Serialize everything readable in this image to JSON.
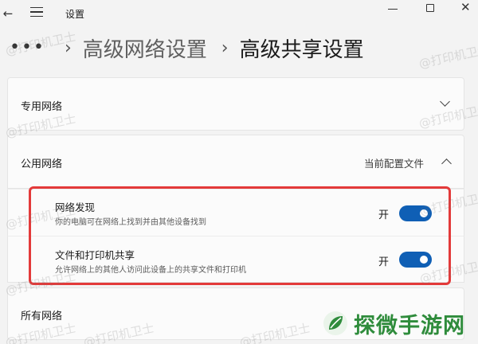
{
  "window": {
    "title": "设置"
  },
  "breadcrumb": {
    "more": "•••",
    "items": [
      "高级网络设置",
      "高级共享设置"
    ]
  },
  "sections": {
    "private": {
      "label": "专用网络",
      "expanded": false
    },
    "public": {
      "label": "公用网络",
      "badge": "当前配置文件",
      "expanded": true,
      "settings": [
        {
          "title": "网络发现",
          "description": "你的电脑可在网络上找到并由其他设备找到",
          "state_label": "开",
          "on": true
        },
        {
          "title": "文件和打印机共享",
          "description": "允许网络上的其他人访问此设备上的共享文件和打印机",
          "state_label": "开",
          "on": true
        }
      ]
    },
    "all": {
      "label": "所有网络"
    }
  },
  "watermark": "@打印机卫士",
  "brand": {
    "name": "探微手游网",
    "color": "#2f8c3c"
  },
  "colors": {
    "accent": "#0f5fb5",
    "highlight": "#e33a3a"
  }
}
